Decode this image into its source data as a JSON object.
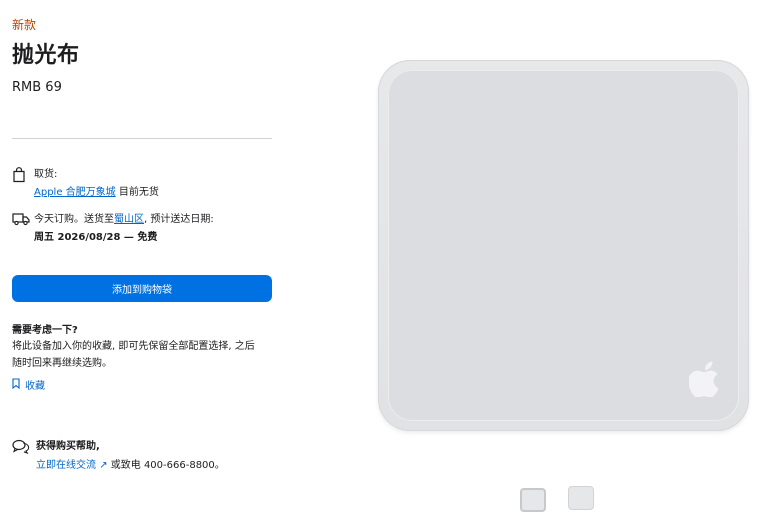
{
  "product": {
    "eyebrow": "新款",
    "title": "抛光布",
    "price": "RMB 69"
  },
  "pickup": {
    "label": "取货:",
    "store_link": "Apple 合肥万象城",
    "availability": "目前无货",
    "icon": "shopping-bag-icon"
  },
  "delivery": {
    "prefix": "今天订购。送货至",
    "district_link": "蜀山区",
    "suffix": ", 预计送达日期:",
    "date": "周五 2026/08/28 — 免费",
    "icon": "delivery-truck-icon"
  },
  "actions": {
    "add_to_bag": "添加到购物袋"
  },
  "consider": {
    "title": "需要考虑一下?",
    "line1": "将此设备加入你的收藏, 即可先保留全部配置选择, 之后",
    "line2": "随时回来再继续选购。",
    "save_label": "收藏",
    "save_icon": "bookmark-icon"
  },
  "help": {
    "title": "获得购买帮助,",
    "chat_link": "立即在线交流",
    "chat_arrow": "↗",
    "phone_text": "或致电 400-666-8800。",
    "icon": "chat-bubbles-icon"
  },
  "colors": {
    "accent": "#0071e3",
    "link": "#0066cc",
    "eyebrow": "#b64400",
    "product_surface": "#dcdde0"
  }
}
